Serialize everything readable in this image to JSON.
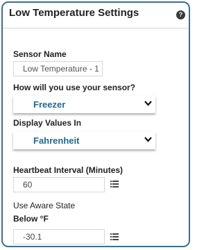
{
  "panel": {
    "title": "Low Temperature Settings",
    "help_glyph": "?"
  },
  "sensor_name": {
    "label": "Sensor Name",
    "value": "Low Temperature - 1"
  },
  "usage": {
    "label": "How will you use your sensor?",
    "selected": "Freezer"
  },
  "display_values": {
    "label": "Display Values In",
    "selected": "Fahrenheit"
  },
  "heartbeat": {
    "label": "Heartbeat Interval (Minutes)",
    "value": "60"
  },
  "aware_state": {
    "label": "Use Aware State"
  },
  "below": {
    "label": "Below °F",
    "value": "-30.1"
  },
  "colors": {
    "border": "#3a6f8d",
    "select_text": "#1d6a92"
  },
  "icons": [
    "help-icon",
    "chevron-down-icon",
    "list-icon"
  ]
}
